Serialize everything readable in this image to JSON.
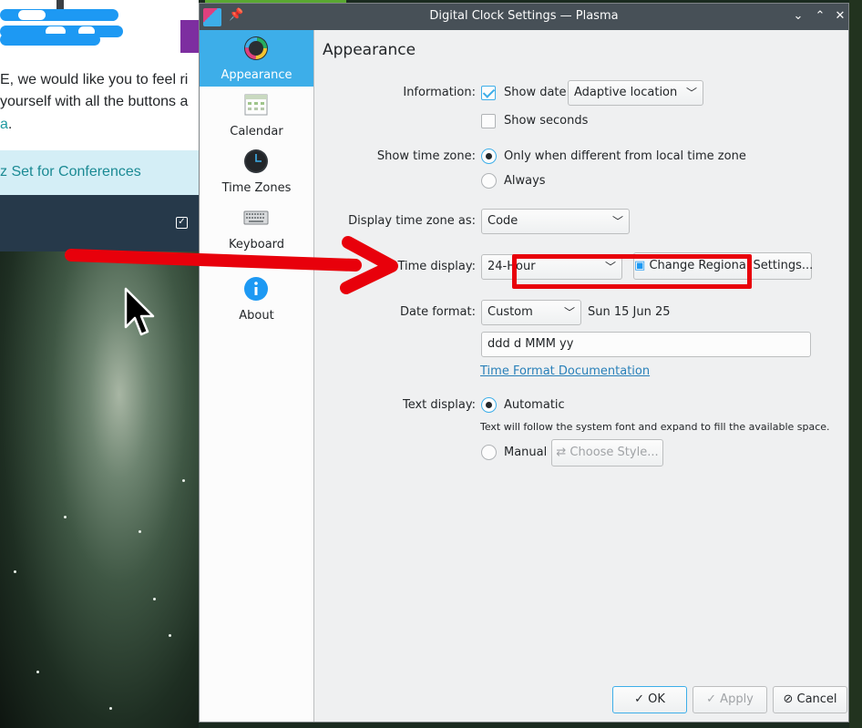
{
  "background": {
    "text_line1": "E, we would like you to feel ri",
    "text_line2": "yourself with all the buttons a",
    "text_line3_link": "a",
    "text_line3_rest": ".",
    "conference_link": "z Set for Conferences"
  },
  "window": {
    "title": "Digital Clock Settings — Plasma",
    "title_buttons": [
      "chevron-down-icon",
      "chevron-up-icon",
      "close-icon"
    ]
  },
  "sidebar": {
    "items": [
      {
        "label": "Appearance",
        "icon": "appearance-icon",
        "active": true
      },
      {
        "label": "Calendar",
        "icon": "calendar-icon",
        "active": false
      },
      {
        "label": "Time Zones",
        "icon": "clock-icon",
        "active": false
      },
      {
        "label": "Keyboard",
        "icon": "keyboard-icon",
        "active": false
      },
      {
        "label": "About",
        "icon": "info-icon",
        "active": false
      }
    ]
  },
  "page": {
    "title": "Appearance"
  },
  "form": {
    "information_label": "Information:",
    "show_date_label": "Show date",
    "show_date_checked": true,
    "date_location_value": "Adaptive location",
    "show_seconds_label": "Show seconds",
    "show_seconds_checked": false,
    "show_time_zone_label": "Show time zone:",
    "tz_option_1": "Only when different from local time zone",
    "tz_option_2": "Always",
    "tz_selected": 1,
    "display_tz_label": "Display time zone as:",
    "display_tz_value": "Code",
    "time_display_label": "Time display:",
    "time_display_value": "24-Hour",
    "change_regional_label": "Change Regional Settings...",
    "date_format_label": "Date format:",
    "date_format_value": "Custom",
    "date_preview": "Sun 15 Jun 25",
    "custom_format_value": "ddd d MMM yy",
    "time_format_doc_link": "Time Format Documentation",
    "text_display_label": "Text display:",
    "automatic_label": "Automatic",
    "automatic_hint": "Text will follow the system font and expand to fill the available space.",
    "manual_label": "Manual",
    "choose_style_label": "Choose Style..."
  },
  "footer": {
    "ok_label": "OK",
    "apply_label": "Apply",
    "cancel_label": "Cancel"
  },
  "colors": {
    "accent": "#3daee9",
    "annotation_red": "#e8000b",
    "titlebar": "#475057"
  }
}
